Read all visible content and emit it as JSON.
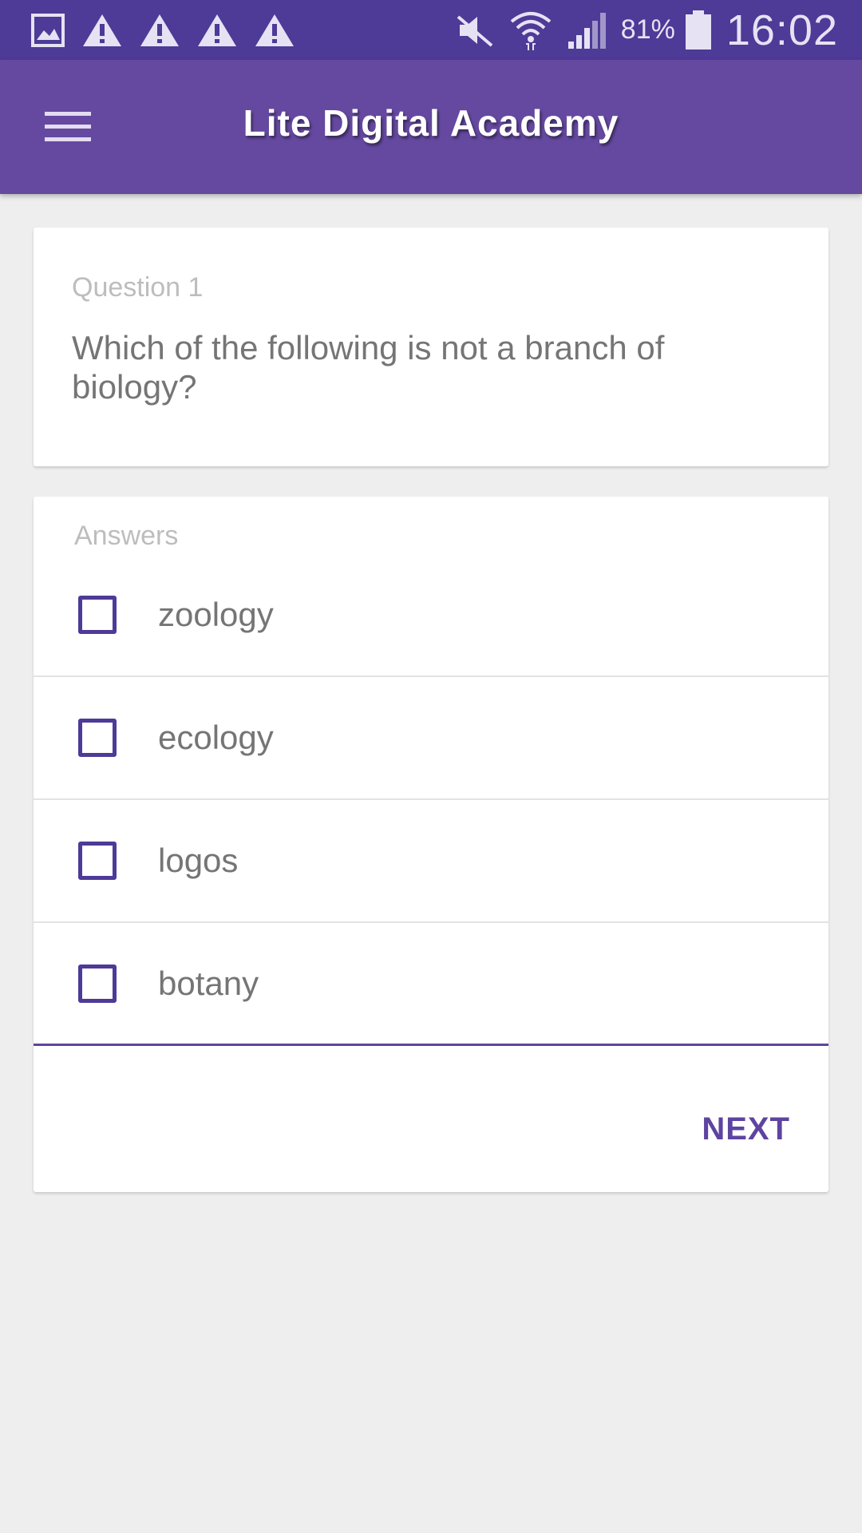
{
  "status_bar": {
    "left_icons": [
      "gallery-icon",
      "warning-icon",
      "warning-icon",
      "warning-icon",
      "warning-icon"
    ],
    "right_icons": [
      "mute-icon",
      "wifi-icon",
      "signal-icon",
      "battery-icon"
    ],
    "battery_percent": "81%",
    "time": "16:02"
  },
  "app_bar": {
    "menu_icon": "hamburger-menu-icon",
    "title": "Lite Digital Academy"
  },
  "question": {
    "label": "Question 1",
    "text": "Which of the following is not a branch of biology?"
  },
  "answers": {
    "label": "Answers",
    "options": [
      {
        "text": "zoology",
        "checked": false
      },
      {
        "text": "ecology",
        "checked": false
      },
      {
        "text": "logos",
        "checked": false
      },
      {
        "text": "botany",
        "checked": false
      }
    ]
  },
  "next_label": "NEXT",
  "colors": {
    "status_bar": "#4e3a97",
    "app_bar": "#6549a0",
    "accent": "#5e44a0",
    "background": "#eeeeee"
  }
}
